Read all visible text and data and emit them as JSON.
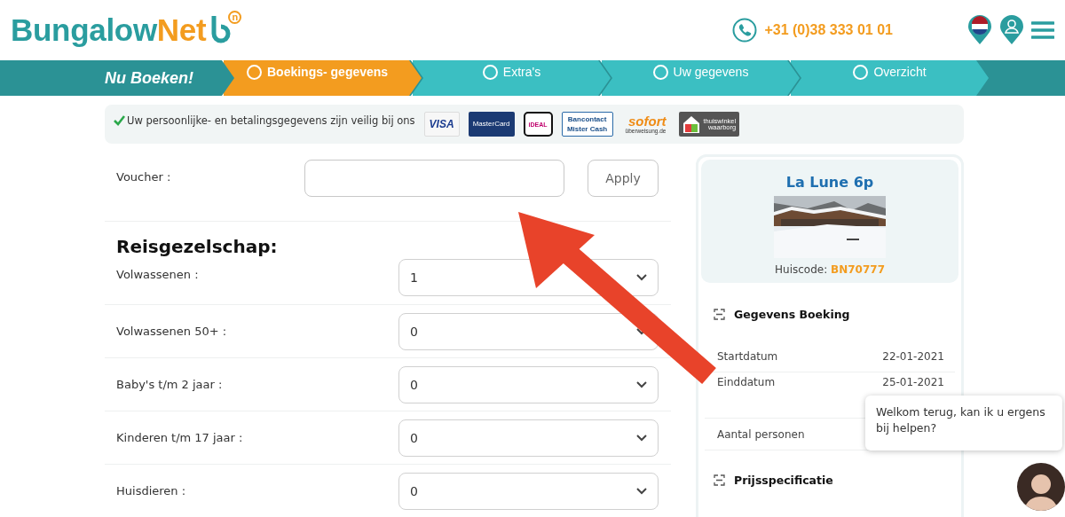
{
  "header": {
    "logo": {
      "part1": "Bungalow",
      "part2": "Net",
      "mark": "n"
    },
    "phone": "+31 (0)38 333 01 01"
  },
  "steps": {
    "title": "Nu Boeken!",
    "items": [
      {
        "label": "Boekings- gegevens",
        "selected": true
      },
      {
        "label": "Extra's",
        "selected": false
      },
      {
        "label": "Uw gegevens",
        "selected": false
      },
      {
        "label": "Overzicht",
        "selected": false
      }
    ]
  },
  "trust": {
    "text": "Uw persoonlijke- en betalingsgegevens zijn veilig bij ons",
    "logos": [
      {
        "kind": "visa",
        "lines": [
          "VISA"
        ]
      },
      {
        "kind": "mastercard",
        "lines": [
          "MasterCard"
        ]
      },
      {
        "kind": "ideal",
        "lines": [
          "iDEAL"
        ]
      },
      {
        "kind": "bancontact",
        "lines": [
          "Bancontact",
          "Mister Cash"
        ]
      },
      {
        "kind": "sofort",
        "lines": [
          "sofort",
          "überweisung.de"
        ]
      },
      {
        "kind": "thuiswinkel",
        "lines": [
          "thuiswinkel",
          "waarborg"
        ]
      }
    ]
  },
  "voucher": {
    "label": "Voucher :",
    "button": "Apply"
  },
  "party": {
    "heading": "Reisgezelschap:",
    "rows": [
      {
        "label": "Volwassenen :",
        "value": "1"
      },
      {
        "label": "Volwassenen 50+ :",
        "value": "0"
      },
      {
        "label": "Baby's t/m 2 jaar :",
        "value": "0"
      },
      {
        "label": "Kinderen t/m 17 jaar :",
        "value": "0"
      },
      {
        "label": "Huisdieren :",
        "value": "0"
      }
    ]
  },
  "sidebar": {
    "title": "La Lune 6p",
    "house_code_label": "Huiscode:",
    "house_code": "BN70777",
    "booking_heading": "Gegevens Boeking",
    "details": [
      {
        "label": "Startdatum",
        "value": "22-01-2021"
      },
      {
        "label": "Einddatum",
        "value": "25-01-2021"
      },
      {
        "label": "Aantal personen"
      }
    ],
    "price_heading": "Prijsspecificatie"
  },
  "chat": {
    "message": "Welkom terug, kan ik u ergens bij helpen?"
  }
}
